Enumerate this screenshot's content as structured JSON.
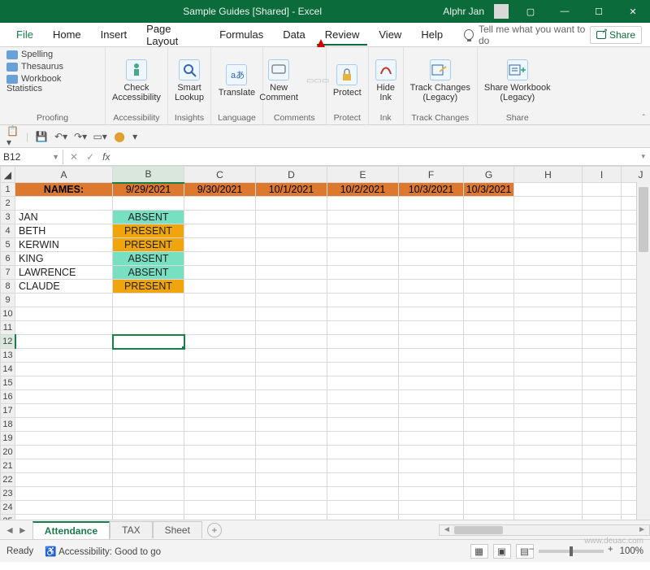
{
  "title": "Sample Guides  [Shared]  -  Excel",
  "user": "Alphr Jan",
  "menus": {
    "file": "File",
    "home": "Home",
    "insert": "Insert",
    "pageLayout": "Page Layout",
    "formulas": "Formulas",
    "data": "Data",
    "review": "Review",
    "view": "View",
    "help": "Help"
  },
  "tellMe": "Tell me what you want to do",
  "share": "Share",
  "ribbon": {
    "proofing": {
      "label": "Proofing",
      "spelling": "Spelling",
      "thesaurus": "Thesaurus",
      "stats": "Workbook Statistics"
    },
    "accessibility": {
      "label": "Accessibility",
      "btn": "Check\nAccessibility"
    },
    "insights": {
      "label": "Insights",
      "btn": "Smart\nLookup"
    },
    "language": {
      "label": "Language",
      "btn": "Translate"
    },
    "comments": {
      "label": "Comments",
      "btn": "New\nComment"
    },
    "protect": {
      "label": "Protect",
      "btn": "Protect"
    },
    "ink": {
      "label": "Ink",
      "btn": "Hide\nInk"
    },
    "trackChanges": {
      "label": "Track Changes",
      "btn": "Track Changes\n(Legacy)"
    },
    "shareGroup": {
      "label": "Share",
      "btn": "Share Workbook\n(Legacy)"
    }
  },
  "nameBox": "B12",
  "columns": [
    "A",
    "B",
    "C",
    "D",
    "E",
    "F",
    "G",
    "H",
    "I",
    "J"
  ],
  "headerRow": {
    "names": "NAMES:",
    "dates": [
      "9/29/2021",
      "9/30/2021",
      "10/1/2021",
      "10/2/2021",
      "10/3/2021",
      "10/3/2021"
    ]
  },
  "rows": [
    {
      "name": "JAN",
      "status": "ABSENT",
      "color": "seaf"
    },
    {
      "name": "BETH",
      "status": "PRESENT",
      "color": "gold"
    },
    {
      "name": "KERWIN",
      "status": "PRESENT",
      "color": "gold"
    },
    {
      "name": "KING",
      "status": "ABSENT",
      "color": "seaf"
    },
    {
      "name": "LAWRENCE",
      "status": "ABSENT",
      "color": "seaf"
    },
    {
      "name": "CLAUDE",
      "status": "PRESENT",
      "color": "gold"
    }
  ],
  "selectedCell": "B12",
  "tabs": {
    "active": "Attendance",
    "t2": "TAX",
    "t3": "Sheet"
  },
  "status": {
    "ready": "Ready",
    "acc": "Accessibility: Good to go"
  },
  "zoom": "100%",
  "watermark": "www.deuac.com"
}
